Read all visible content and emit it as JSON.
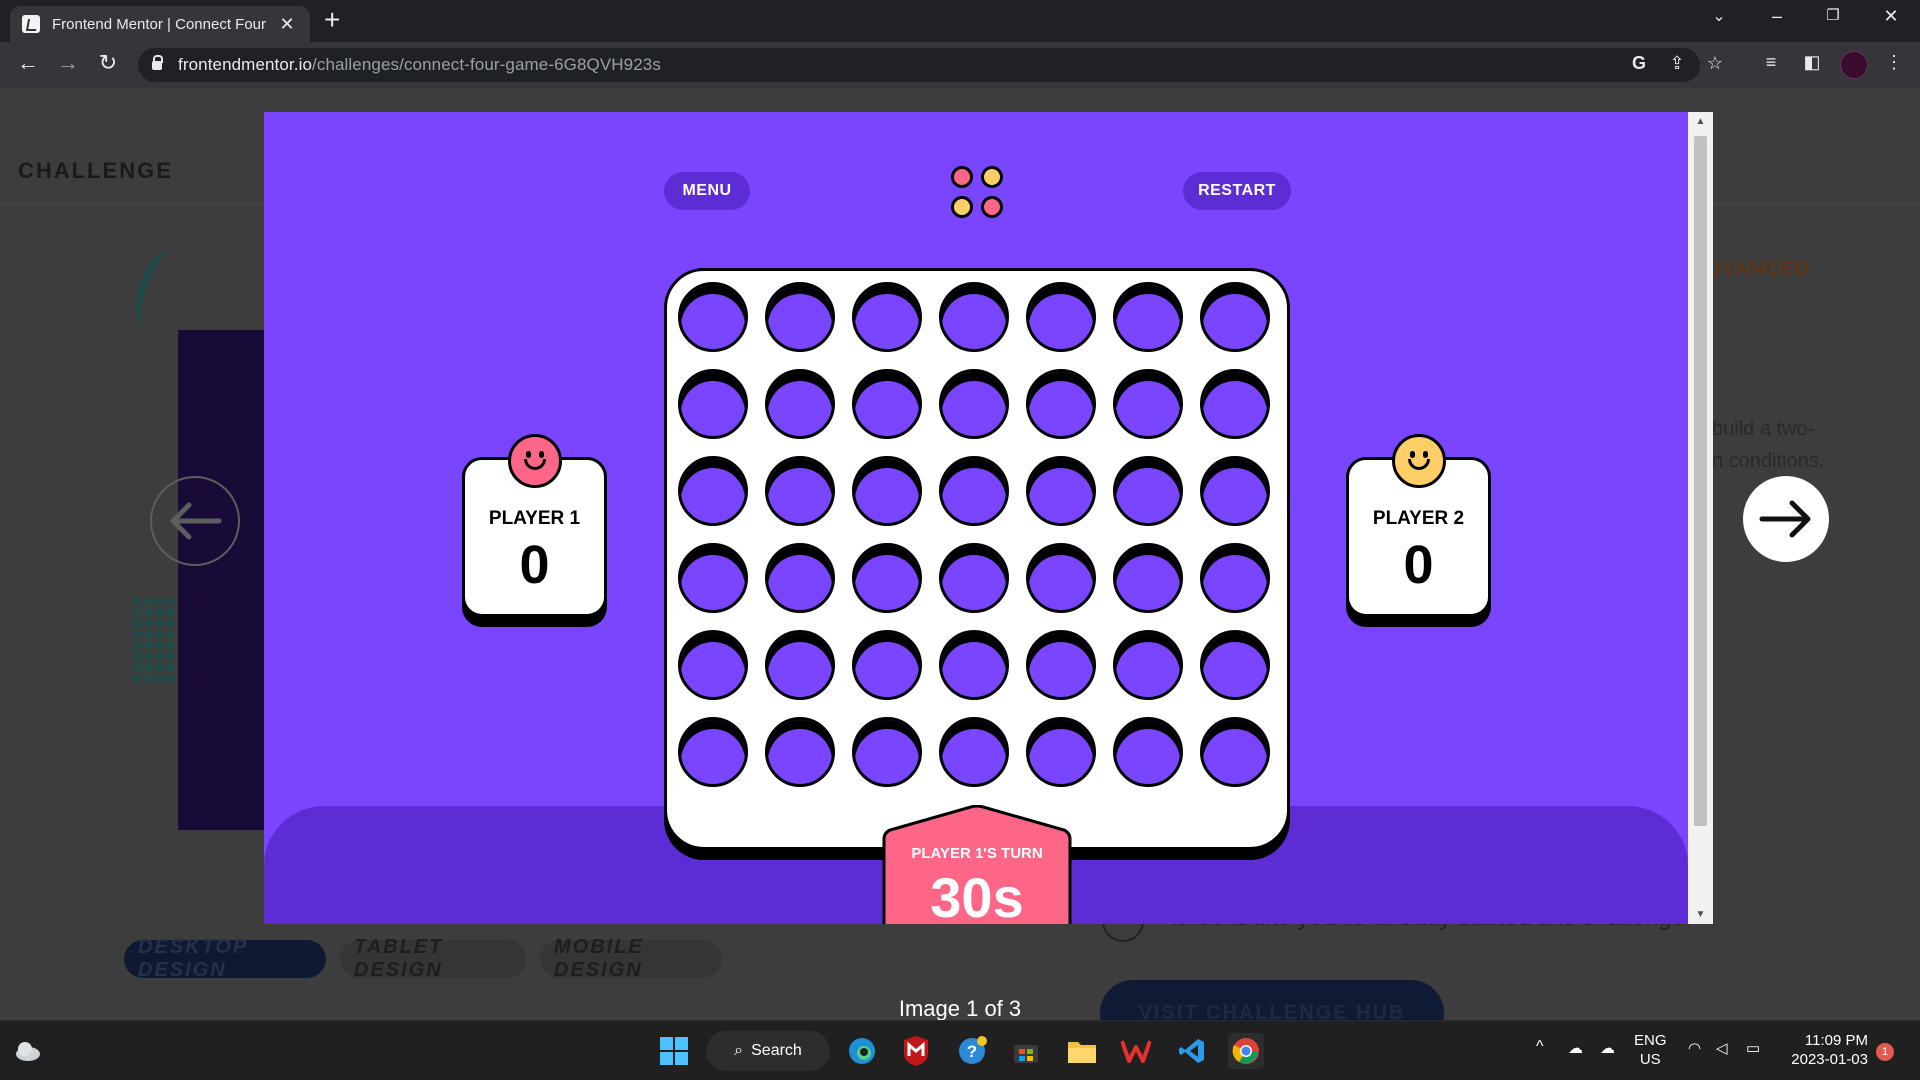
{
  "browser": {
    "tab_title": "Frontend Mentor | Connect Four",
    "url_domain": "frontendmentor.io",
    "url_path": "/challenges/connect-four-game-6G8QVH923s"
  },
  "page": {
    "section_label": "CHALLENGE",
    "difficulty_badge": "DVANCED",
    "description_line1": "build a two-",
    "description_line2": "n conditions.",
    "design_tabs": [
      "DESKTOP DESIGN",
      "TABLET DESIGN",
      "MOBILE DESIGN"
    ],
    "started_note": "It looks like you've already started this challenge.",
    "visit_button": "VISIT CHALLENGE HUB",
    "image_caption": "Image 1 of 3"
  },
  "game": {
    "menu_label": "MENU",
    "restart_label": "RESTART",
    "colors": {
      "purple": "#7945ff",
      "dark_purple": "#5c2dd5",
      "red": "#fd6687",
      "yellow": "#ffce67"
    },
    "board": {
      "rows": 6,
      "cols": 7
    },
    "player1": {
      "name": "PLAYER 1",
      "score": "0"
    },
    "player2": {
      "name": "PLAYER 2",
      "score": "0"
    },
    "turn": {
      "label": "PLAYER 1'S TURN",
      "timer": "30s"
    }
  },
  "taskbar": {
    "search_label": "Search",
    "language": "ENG",
    "region": "US",
    "time": "11:09 PM",
    "date": "2023-01-03",
    "notifications": "1"
  }
}
